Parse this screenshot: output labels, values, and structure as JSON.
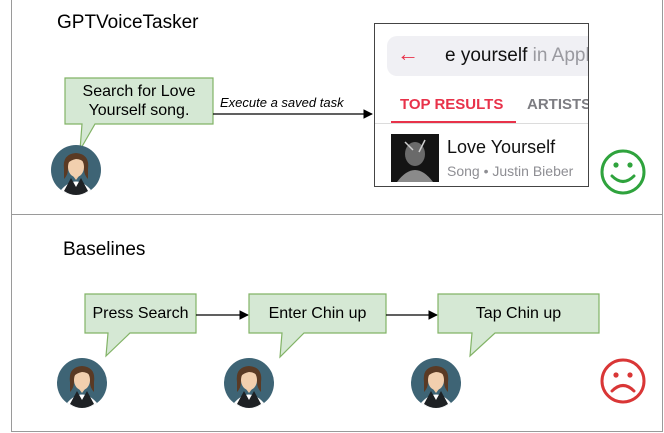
{
  "top_section": {
    "title": "GPTVoiceTasker",
    "bubble_line1": "Search for Love",
    "bubble_line2": "Yourself song.",
    "arrow_label": "Execute a saved task",
    "screenshot": {
      "query_prefix": "e yourself",
      "query_suffix": " in Apple",
      "back_icon": "back-arrow-icon",
      "tab_active": "TOP RESULTS",
      "tab_other": "ARTISTS",
      "song_title": "Love Yourself",
      "song_subtitle": "Song • Justin Bieber"
    },
    "result_icon": "happy-face-icon"
  },
  "bottom_section": {
    "title": "Baselines",
    "steps": [
      "Press Search",
      "Enter Chin up",
      "Tap Chin up"
    ],
    "result_icon": "sad-face-icon"
  },
  "colors": {
    "bubble_fill": "#d5e8d4",
    "bubble_stroke": "#82b366",
    "happy": "#2fa33d",
    "sad": "#d93636",
    "accent": "#e8324a"
  }
}
